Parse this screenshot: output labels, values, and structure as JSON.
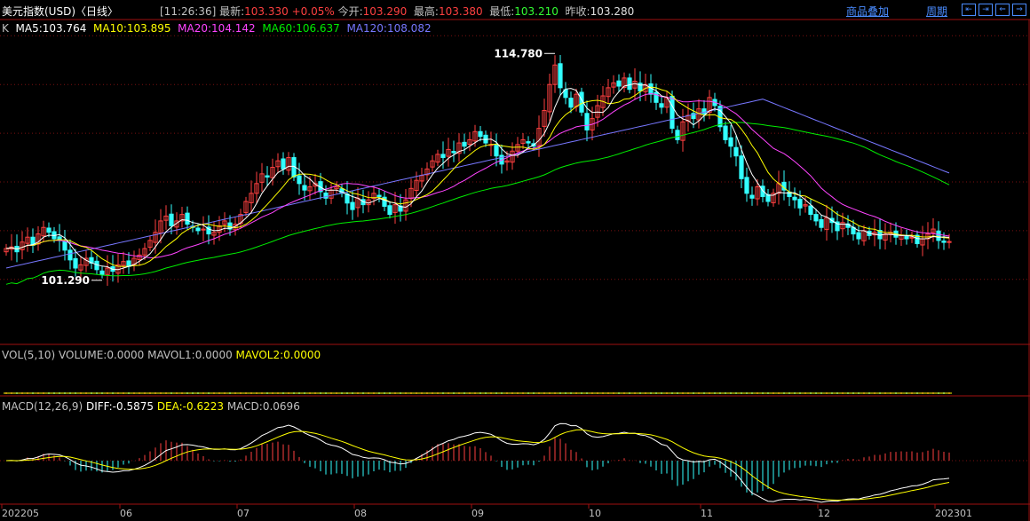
{
  "header": {
    "title": "美元指数(USD)〈日线〉",
    "time": "[11:26:36]",
    "latest_label": "最新:",
    "latest_value": "103.330",
    "change": "+0.05%",
    "open_label": "今开:",
    "open_value": "103.290",
    "high_label": "最高:",
    "high_value": "103.380",
    "low_label": "最低:",
    "low_value": "103.210",
    "prev_label": "昨收:",
    "prev_value": "103.280",
    "overlay_link": "商品叠加",
    "period_link": "周期",
    "nav_buttons": [
      "⇤",
      "⇥",
      "⇐",
      "⇒"
    ]
  },
  "colors": {
    "up": "#ff4040",
    "down": "#33ffff",
    "ma5": "#ffffff",
    "ma10": "#ffff00",
    "ma20": "#ff44ff",
    "ma60": "#00ee00",
    "ma120": "#7777ff"
  },
  "chart_data": [
    {
      "type": "candlestick",
      "name": "K",
      "legend": [
        {
          "text": "K",
          "color": "#c0c0c0"
        },
        {
          "text": "MA5:103.764",
          "color": "#ffffff"
        },
        {
          "text": "MA10:103.895",
          "color": "#ffff00"
        },
        {
          "text": "MA20:104.142",
          "color": "#ff44ff"
        },
        {
          "text": "MA60:106.637",
          "color": "#00ee00"
        },
        {
          "text": "MA120:108.082",
          "color": "#7777ff"
        }
      ],
      "annotations": {
        "high": "114.780",
        "low": "101.290"
      },
      "close": [
        102.9,
        103.0,
        102.7,
        103.3,
        103.6,
        103.1,
        103.8,
        104.2,
        103.9,
        103.5,
        103.4,
        102.8,
        102.2,
        101.7,
        101.9,
        102.3,
        102.0,
        101.6,
        101.3,
        101.7,
        101.5,
        101.9,
        102.1,
        101.8,
        102.3,
        102.5,
        102.9,
        103.4,
        103.9,
        104.6,
        104.9,
        104.3,
        104.6,
        105.0,
        104.4,
        104.2,
        104.0,
        104.1,
        103.8,
        103.9,
        104.3,
        104.6,
        104.1,
        104.4,
        105.0,
        105.8,
        106.3,
        106.9,
        107.5,
        107.3,
        107.9,
        108.3,
        107.8,
        108.5,
        107.3,
        106.9,
        106.5,
        106.7,
        106.9,
        106.4,
        106.0,
        106.5,
        106.7,
        106.3,
        105.7,
        105.3,
        106.0,
        105.6,
        105.9,
        106.3,
        106.1,
        105.5,
        105.0,
        105.6,
        105.2,
        105.9,
        106.6,
        107.1,
        107.4,
        107.8,
        108.3,
        108.7,
        108.5,
        109.0,
        108.8,
        109.4,
        109.2,
        109.6,
        110.1,
        109.8,
        109.4,
        109.3,
        108.6,
        108.1,
        108.3,
        108.9,
        109.3,
        109.6,
        109.4,
        109.2,
        110.3,
        111.4,
        113.0,
        114.2,
        112.8,
        112.2,
        111.6,
        112.4,
        111.3,
        110.2,
        110.9,
        111.7,
        112.3,
        112.8,
        113.1,
        112.9,
        113.4,
        112.7,
        113.2,
        112.6,
        113.0,
        112.4,
        111.9,
        111.6,
        112.2,
        110.3,
        109.6,
        110.7,
        111.1,
        110.9,
        111.5,
        111.2,
        112.2,
        111.7,
        110.4,
        109.6,
        109.2,
        108.6,
        107.2,
        106.3,
        106.0,
        106.7,
        106.1,
        105.8,
        106.3,
        106.9,
        106.5,
        106.1,
        105.9,
        105.4,
        105.6,
        105.0,
        104.6,
        104.2,
        104.8,
        104.5,
        104.0,
        104.5,
        104.2,
        103.8,
        103.5,
        104.0,
        103.7,
        103.9,
        103.5,
        103.8,
        103.9,
        103.6,
        103.7,
        103.5,
        103.6,
        103.2,
        103.5,
        103.8,
        104.1,
        103.4,
        103.28,
        103.33
      ],
      "highlight": {
        "max_index": 103,
        "min_index": 18
      }
    },
    {
      "type": "bar",
      "name": "VOL",
      "legend": [
        {
          "text": "VOL(5,10) VOLUME:0.0000 MAVOL1:0.0000",
          "color": "#c0c0c0"
        },
        {
          "text": "MAVOL2:0.0000",
          "color": "#ffff00"
        }
      ]
    },
    {
      "type": "macd",
      "name": "MACD",
      "legend": [
        {
          "text": "MACD(12,26,9)",
          "color": "#c0c0c0"
        },
        {
          "text": "DIFF:-0.5875",
          "color": "#ffffff"
        },
        {
          "text": "DEA:-0.6223",
          "color": "#ffff00"
        },
        {
          "text": "MACD:0.0696",
          "color": "#c0c0c0"
        }
      ]
    }
  ],
  "x_axis": [
    {
      "label": "202205",
      "index": 0
    },
    {
      "label": "06",
      "index": 22
    },
    {
      "label": "07",
      "index": 44
    },
    {
      "label": "08",
      "index": 66
    },
    {
      "label": "09",
      "index": 88
    },
    {
      "label": "10",
      "index": 110
    },
    {
      "label": "11",
      "index": 131
    },
    {
      "label": "12",
      "index": 153
    },
    {
      "label": "202301",
      "index": 175
    }
  ]
}
